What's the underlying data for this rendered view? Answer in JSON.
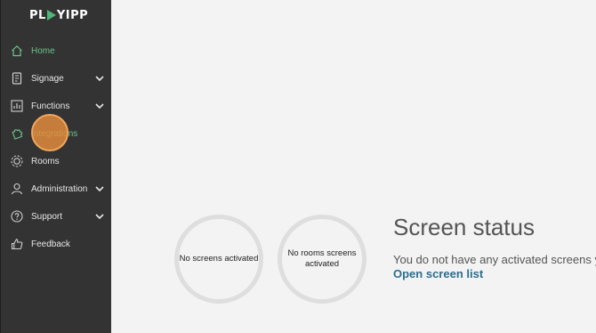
{
  "logo": {
    "text_left": "PL",
    "text_right": "YIPP"
  },
  "sidebar": {
    "items": [
      {
        "label": "Home",
        "icon": "home-icon"
      },
      {
        "label": "Signage",
        "icon": "signage-icon"
      },
      {
        "label": "Functions",
        "icon": "functions-icon"
      },
      {
        "label": "Integrations",
        "icon": "puzzle-icon"
      },
      {
        "label": "Rooms",
        "icon": "rooms-icon"
      },
      {
        "label": "Administration",
        "icon": "user-icon"
      },
      {
        "label": "Support",
        "icon": "help-icon"
      },
      {
        "label": "Feedback",
        "icon": "thumbs-up-icon"
      }
    ]
  },
  "main": {
    "screens_ring": {
      "text": "No screens activated"
    },
    "rooms_ring": {
      "text": "No rooms screens activated"
    },
    "status_title": "Screen status",
    "status_text": "You do not have any activated screens y",
    "status_link": "Open screen list"
  },
  "colors": {
    "accent": "#6cc38b",
    "sidebar": "#333333",
    "link": "#2c6e8e",
    "highlight": "#e68c3c"
  }
}
